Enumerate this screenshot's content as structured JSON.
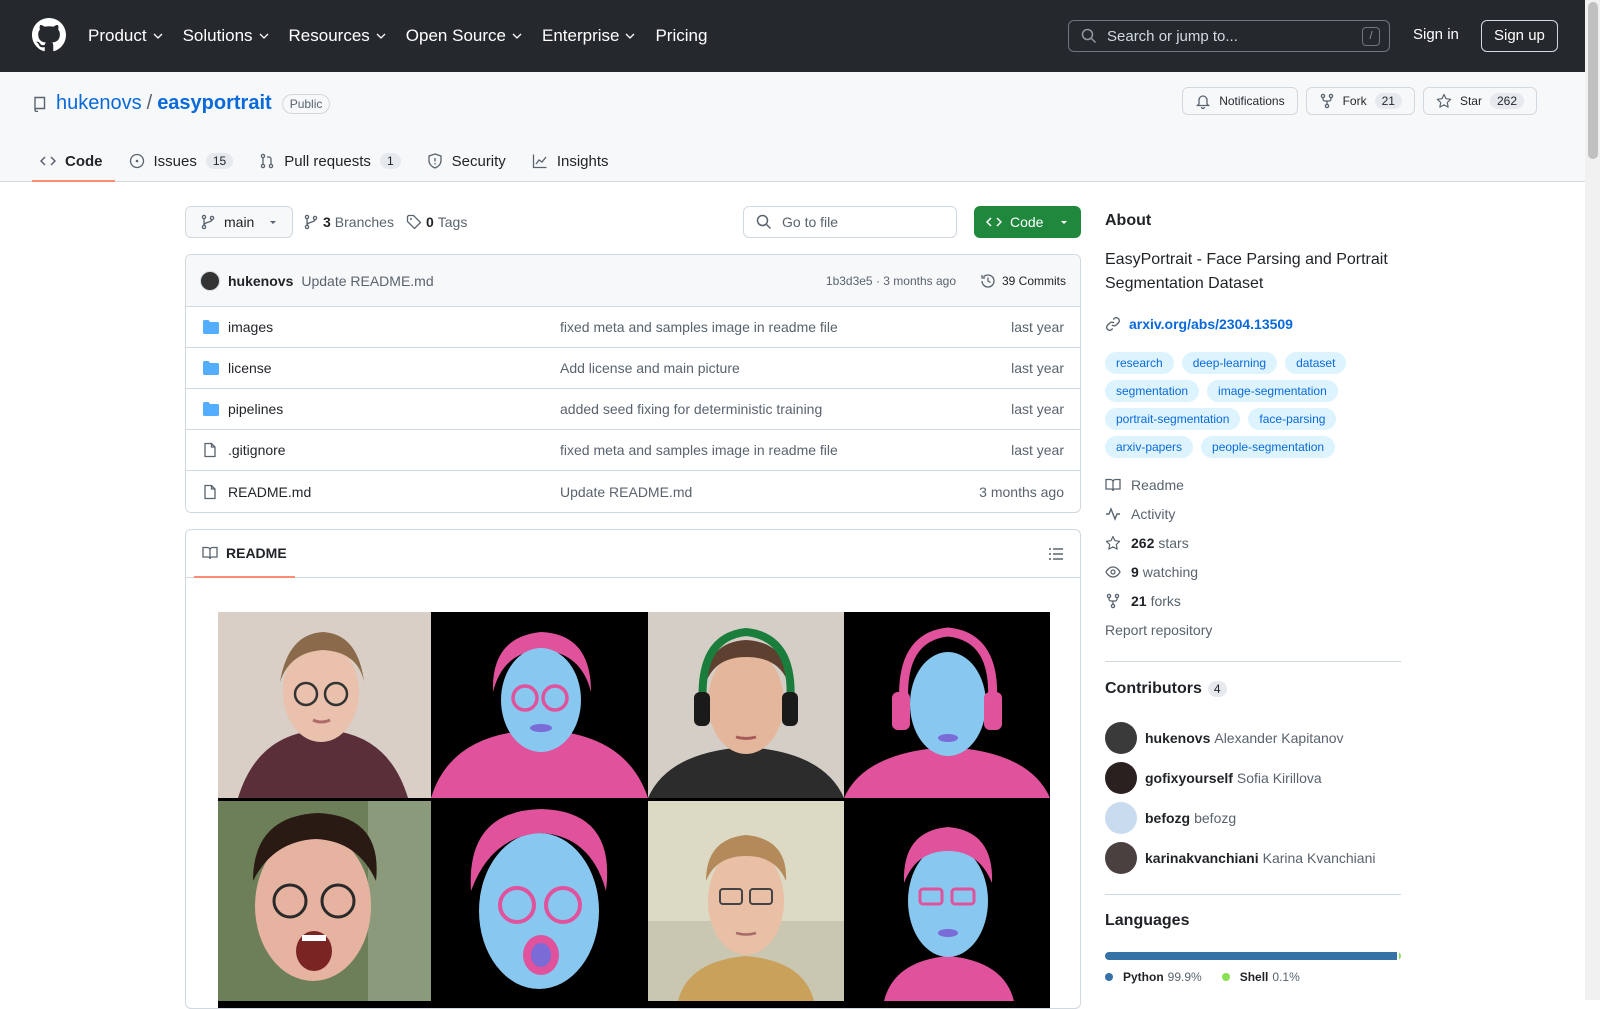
{
  "header": {
    "nav": [
      "Product",
      "Solutions",
      "Resources",
      "Open Source",
      "Enterprise",
      "Pricing"
    ],
    "search_placeholder": "Search or jump to...",
    "search_key": "/",
    "signin": "Sign in",
    "signup": "Sign up"
  },
  "repo": {
    "owner": "hukenovs",
    "sep": "/",
    "name": "easyportrait",
    "visibility": "Public",
    "notifications": "Notifications",
    "fork_label": "Fork",
    "fork_count": "21",
    "star_label": "Star",
    "star_count": "262"
  },
  "tabs": [
    {
      "label": "Code",
      "count": ""
    },
    {
      "label": "Issues",
      "count": "15"
    },
    {
      "label": "Pull requests",
      "count": "1"
    },
    {
      "label": "Security",
      "count": ""
    },
    {
      "label": "Insights",
      "count": ""
    }
  ],
  "toolbar": {
    "branch": "main",
    "branches_count": "3",
    "branches_label": "Branches",
    "tags_count": "0",
    "tags_label": "Tags",
    "goto_placeholder": "Go to file",
    "code_label": "Code"
  },
  "commit": {
    "author": "hukenovs",
    "message": "Update README.md",
    "sha_time": "1b3d3e5 · 3 months ago",
    "commits": "39 Commits"
  },
  "files": [
    {
      "type": "folder",
      "name": "images",
      "msg": "fixed meta and samples image in readme file",
      "date": "last year"
    },
    {
      "type": "folder",
      "name": "license",
      "msg": "Add license and main picture",
      "date": "last year"
    },
    {
      "type": "folder",
      "name": "pipelines",
      "msg": "added seed fixing for deterministic training",
      "date": "last year"
    },
    {
      "type": "file",
      "name": ".gitignore",
      "msg": "fixed meta and samples image in readme file",
      "date": "last year"
    },
    {
      "type": "file",
      "name": "README.md",
      "msg": "Update README.md",
      "date": "3 months ago"
    }
  ],
  "readme": {
    "title": "README"
  },
  "about": {
    "heading": "About",
    "description": "EasyPortrait - Face Parsing and Portrait Segmentation Dataset",
    "link": "arxiv.org/abs/2304.13509",
    "topics": [
      "research",
      "deep-learning",
      "dataset",
      "segmentation",
      "image-segmentation",
      "portrait-segmentation",
      "face-parsing",
      "arxiv-papers",
      "people-segmentation"
    ],
    "readme": "Readme",
    "activity": "Activity",
    "stars_count": "262",
    "stars_label": "stars",
    "watching_count": "9",
    "watching_label": "watching",
    "forks_count": "21",
    "forks_label": "forks",
    "report": "Report repository"
  },
  "contributors": {
    "heading": "Contributors",
    "count": "4",
    "list": [
      {
        "login": "hukenovs",
        "name": "Alexander Kapitanov"
      },
      {
        "login": "gofixyourself",
        "name": "Sofia Kirillova"
      },
      {
        "login": "befozg",
        "name": "befozg"
      },
      {
        "login": "karinakvanchiani",
        "name": "Karina Kvanchiani"
      }
    ]
  },
  "languages": {
    "heading": "Languages",
    "items": [
      {
        "name": "Python",
        "pct": "99.9%",
        "value": 99.9,
        "color": "#3572A5"
      },
      {
        "name": "Shell",
        "pct": "0.1%",
        "value": 0.1,
        "color": "#89e051"
      }
    ]
  },
  "colors": {
    "accent": "#0969da",
    "green": "#1f883d",
    "tab_underline": "#fd8c73",
    "header_bg": "#25292e"
  }
}
